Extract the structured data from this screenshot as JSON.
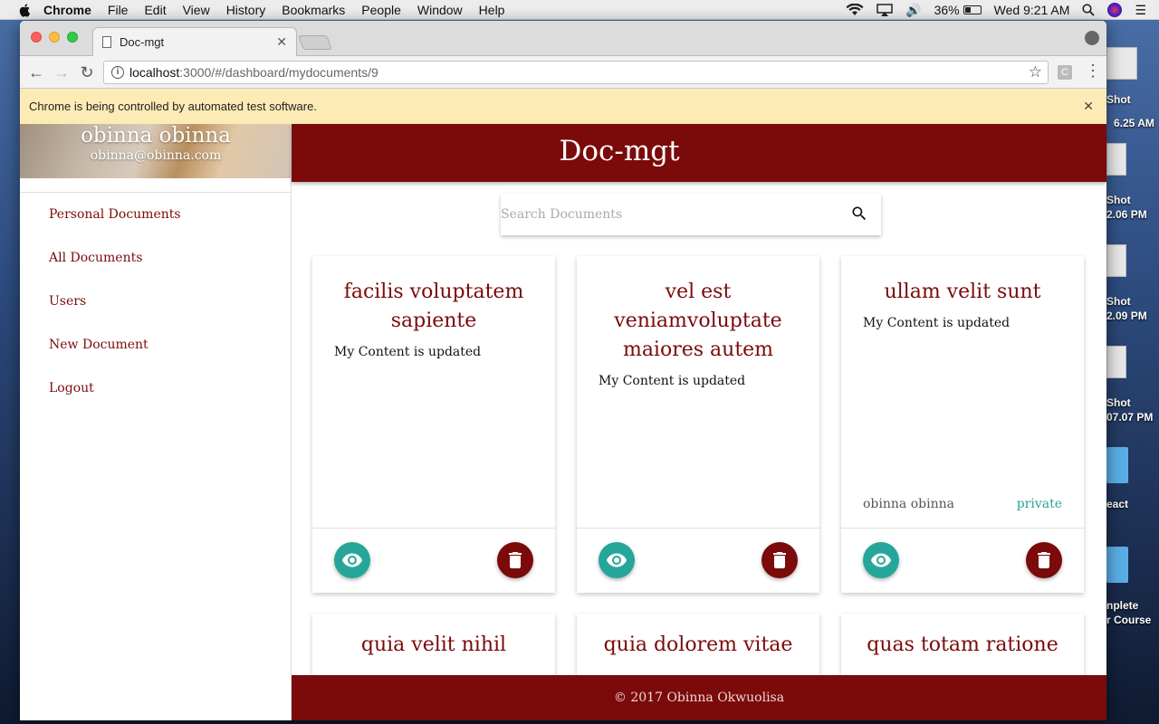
{
  "menubar": {
    "app": "Chrome",
    "items": [
      "File",
      "Edit",
      "View",
      "History",
      "Bookmarks",
      "People",
      "Window",
      "Help"
    ],
    "battery": "36%",
    "clock": "Wed 9:21 AM",
    "battery_level": 0.36
  },
  "desktop": {
    "labels": [
      "Shot",
      "Shot",
      "Shot",
      "Shot",
      "eact",
      "nplete",
      "r Course"
    ],
    "sub": [
      "6.25 AM",
      "2.06 PM",
      "2.09 PM",
      "07.07 PM"
    ],
    "top_label": "Shot"
  },
  "browser": {
    "tab_title": "Doc-mgt",
    "url_host": "localhost",
    "url_path": ":3000/#/dashboard/mydocuments/9",
    "infobar": "Chrome is being controlled by automated test software.",
    "ext_label": "C"
  },
  "app": {
    "brand": "Doc-mgt",
    "user": {
      "name": "obinna obinna",
      "email": "obinna@obinna.com"
    },
    "nav": [
      "Personal Documents",
      "All Documents",
      "Users",
      "New Document",
      "Logout"
    ],
    "search": {
      "placeholder": "Search Documents"
    },
    "cards": [
      {
        "title": "facilis voluptatem sapiente",
        "content": "My Content is updated",
        "owner": "",
        "access": ""
      },
      {
        "title": "vel est veniamvoluptate maiores autem",
        "content": "My Content is updated",
        "owner": "",
        "access": ""
      },
      {
        "title": "ullam velit sunt",
        "content": "My Content is updated",
        "owner": "obinna obinna",
        "access": "private"
      }
    ],
    "cards_row2": [
      "quia velit nihil",
      "quia dolorem vitae",
      "quas totam ratione"
    ],
    "footer": "© 2017 Obinna Okwuolisa"
  },
  "colors": {
    "primary": "#7b0a0a",
    "accent": "#26a69a"
  }
}
